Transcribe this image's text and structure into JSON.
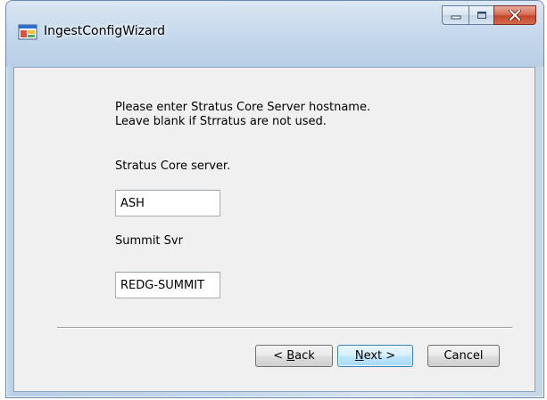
{
  "window": {
    "title": "IngestConfigWizard",
    "icon": "application-window-icon",
    "caption_buttons": [
      "minimize-icon",
      "maximize-icon",
      "close-icon"
    ]
  },
  "instructions": {
    "line1": "Please enter Stratus Core Server hostname.",
    "line2": "Leave blank if Strratus are not used."
  },
  "stratus": {
    "label": "Stratus Core server.",
    "value": "ASH"
  },
  "summit": {
    "label": "Summit Svr",
    "value": "REDG-SUMMIT"
  },
  "buttons": {
    "back_prefix": "< ",
    "back_mnemonic": "B",
    "back_rest": "ack",
    "next_mnemonic": "N",
    "next_rest": "ext >",
    "cancel": "Cancel"
  },
  "colors": {
    "titlebar": "#c7d9ec",
    "client_background": "#f0f0f0",
    "close_button": "#c4462a",
    "default_button_border": "#3c7fb1"
  }
}
